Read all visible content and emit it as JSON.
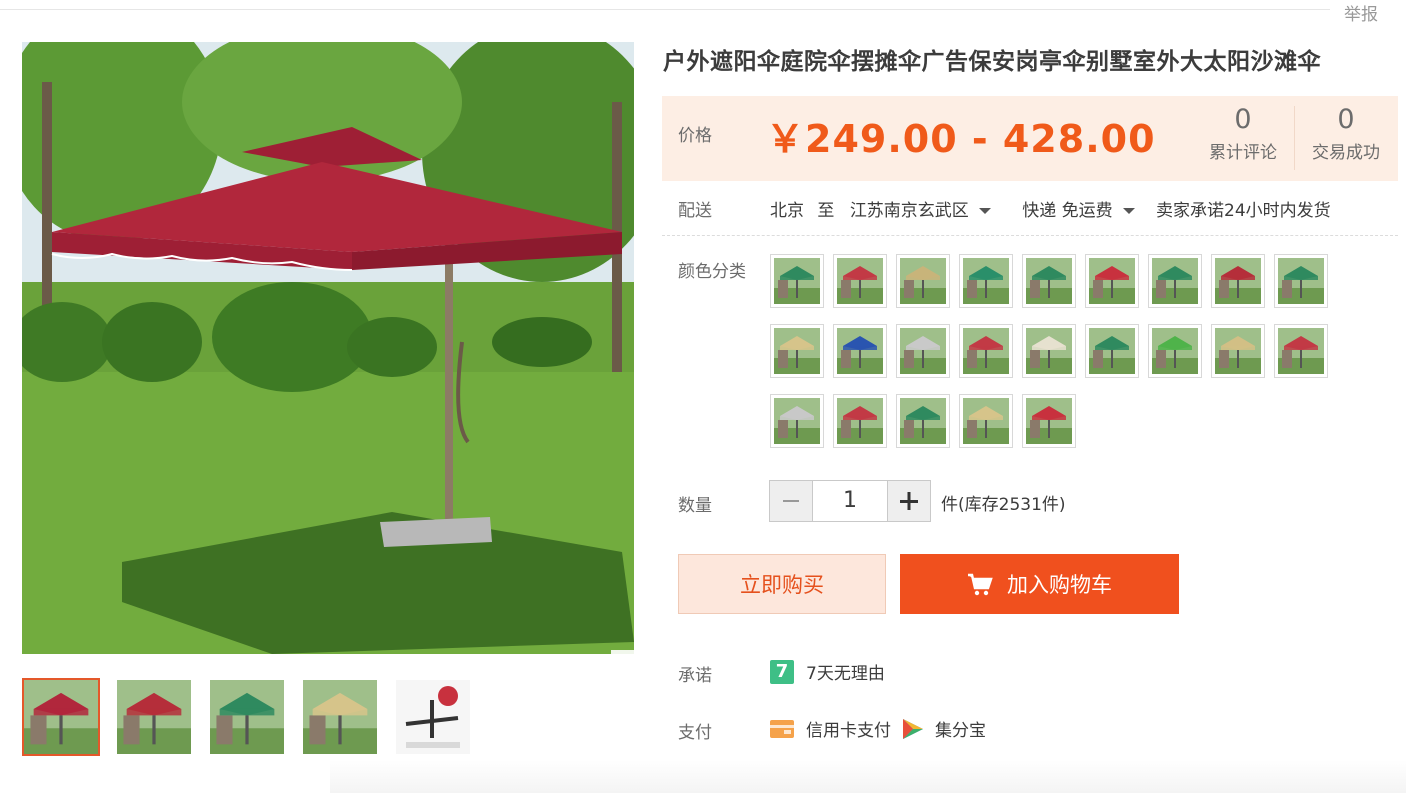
{
  "header": {
    "report_label": "举报"
  },
  "product": {
    "title": "户外遮阳伞庭院伞摆摊伞广告保安岗亭伞别墅室外大太阳沙滩伞",
    "price_label": "价格",
    "price": "￥249.00 - 428.00",
    "reviews_count": "0",
    "reviews_label": "累计评论",
    "deals_count": "0",
    "deals_label": "交易成功"
  },
  "shipping": {
    "label": "配送",
    "from": "北京",
    "to_word": "至",
    "destination": "江苏南京玄武区",
    "method": "快递 免运费",
    "promise": "卖家承诺24小时内发货"
  },
  "colors": {
    "label": "颜色分类",
    "swatches": [
      "#2f8a5f",
      "#c23a45",
      "#c8b47a",
      "#2a8f6a",
      "#2f8a5f",
      "#c8313e",
      "#2f8a5f",
      "#b52e3a",
      "#2f8a5f",
      "#d6c48a",
      "#2a55b0",
      "#c9c9c9",
      "#c23a45",
      "#e6e1cf",
      "#2f8a5f",
      "#4fb34a",
      "#d2bf85",
      "#c23a45",
      "#c8c8c8",
      "#c23a45",
      "#2f8a5f",
      "#d6c48a",
      "#c8313e"
    ]
  },
  "quantity": {
    "label": "数量",
    "value": "1",
    "stock_text": "件(库存2531件)"
  },
  "actions": {
    "buy_now": "立即购买",
    "add_to_cart": "加入购物车"
  },
  "promise": {
    "label": "承诺",
    "badge": "7",
    "text": "7天无理由"
  },
  "payment": {
    "label": "支付",
    "method1": "信用卡支付",
    "method2": "集分宝"
  },
  "gallery": {
    "thumb_colors": [
      "#b1273c",
      "#b52e3a",
      "#2f8a5f",
      "#d6c48a",
      "#c8313e"
    ],
    "active_index": 0
  }
}
